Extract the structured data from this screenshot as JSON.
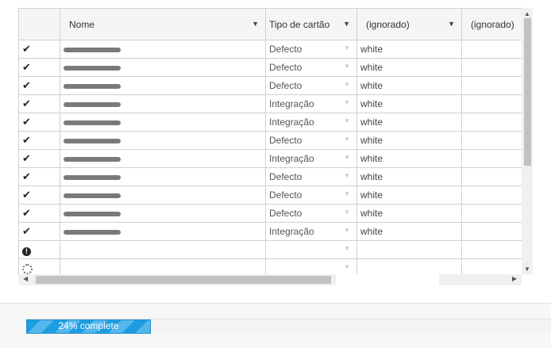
{
  "grid": {
    "columns": [
      {
        "label": "",
        "sort": ""
      },
      {
        "label": "Nome",
        "sort": "▼"
      },
      {
        "label": "Tipo de cartão",
        "sort": "▼"
      },
      {
        "label": "(ignorado)",
        "sort": "▼"
      },
      {
        "label": "(ignorado)",
        "sort": ""
      }
    ],
    "rows": [
      {
        "status": "✔",
        "type": "Defecto",
        "color": "white"
      },
      {
        "status": "✔",
        "type": "Defecto",
        "color": "white"
      },
      {
        "status": "✔",
        "type": "Defecto",
        "color": "white"
      },
      {
        "status": "✔",
        "type": "Integração",
        "color": "white"
      },
      {
        "status": "✔",
        "type": "Integração",
        "color": "white"
      },
      {
        "status": "✔",
        "type": "Defecto",
        "color": "white"
      },
      {
        "status": "✔",
        "type": "Integração",
        "color": "white"
      },
      {
        "status": "✔",
        "type": "Defecto",
        "color": "white"
      },
      {
        "status": "✔",
        "type": "Defecto",
        "color": "white"
      },
      {
        "status": "✔",
        "type": "Defecto",
        "color": "white"
      },
      {
        "status": "✔",
        "type": "Integração",
        "color": "white"
      }
    ],
    "error_row_icon": "!",
    "dropdown_glyph": "▼"
  },
  "progress": {
    "label": "24% complete",
    "percent": 24,
    "color": "#1e9ee0"
  },
  "icons": {
    "check": "check-icon",
    "error": "exclamation-circle-icon",
    "loading": "spinner-icon"
  }
}
